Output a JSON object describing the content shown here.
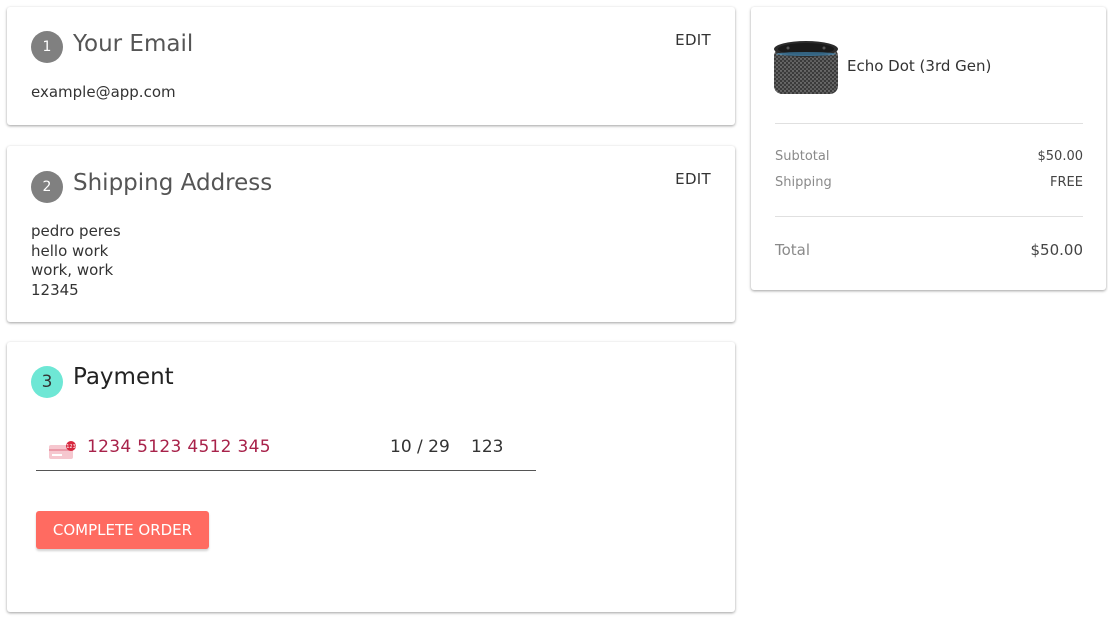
{
  "steps": {
    "email": {
      "number": "1",
      "title": "Your Email",
      "edit_label": "EDIT",
      "value": "example@app.com"
    },
    "shipping": {
      "number": "2",
      "title": "Shipping Address",
      "edit_label": "EDIT",
      "address_lines": [
        "pedro peres",
        "hello work",
        "work, work",
        "12345"
      ]
    },
    "payment": {
      "number": "3",
      "title": "Payment",
      "card_number": "1234 5123 4512 345",
      "card_expiry": "10 / 29",
      "card_cvc": "123",
      "submit_label": "COMPLETE ORDER",
      "card_brand_icon": "card-error-icon"
    }
  },
  "summary": {
    "product": {
      "name": "Echo Dot (3rd Gen)",
      "image_icon": "echo-dot-speaker"
    },
    "subtotal_label": "Subtotal",
    "subtotal_value": "$50.00",
    "shipping_label": "Shipping",
    "shipping_value": "FREE",
    "total_label": "Total",
    "total_value": "$50.00"
  },
  "colors": {
    "accent_button": "#ff6b61",
    "active_step": "#6ee7d5",
    "inactive_step": "#808080",
    "card_number_text": "#a8224a"
  }
}
